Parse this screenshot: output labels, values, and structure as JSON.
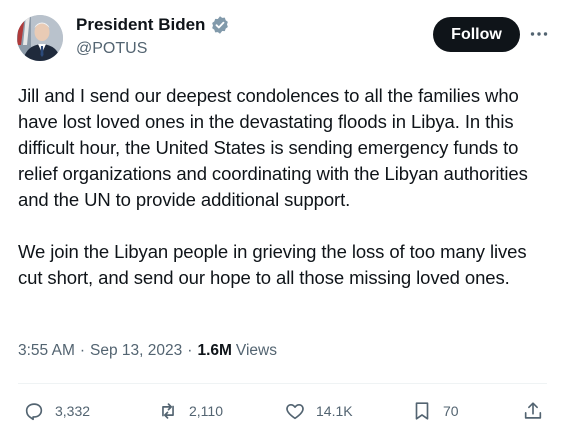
{
  "author": {
    "name": "President Biden",
    "handle": "@POTUS"
  },
  "follow_label": "Follow",
  "tweet": {
    "paragraphs": [
      "Jill and I send our deepest condolences to all the families who have lost loved ones in the devastating floods in Libya. In this difficult hour, the United States is sending emergency funds to relief organizations and coordinating with the Libyan authorities and the UN to provide additional support.",
      "We join the Libyan people in grieving the loss of too many lives cut short, and send our hope to all those missing loved ones."
    ],
    "time": "3:55 AM",
    "date": "Sep 13, 2023",
    "views_count": "1.6M",
    "views_label": "Views"
  },
  "actions": {
    "replies": "3,332",
    "reposts": "2,110",
    "likes": "14.1K",
    "bookmarks": "70"
  },
  "icons": {
    "verified": "verified-badge-icon",
    "more": "more-icon",
    "reply": "reply-icon",
    "repost": "repost-icon",
    "like": "heart-icon",
    "bookmark": "bookmark-icon",
    "share": "share-icon"
  },
  "colors": {
    "verified_badge": "#829aab",
    "follow_button": "#0f1419",
    "secondary_text": "#536471"
  }
}
